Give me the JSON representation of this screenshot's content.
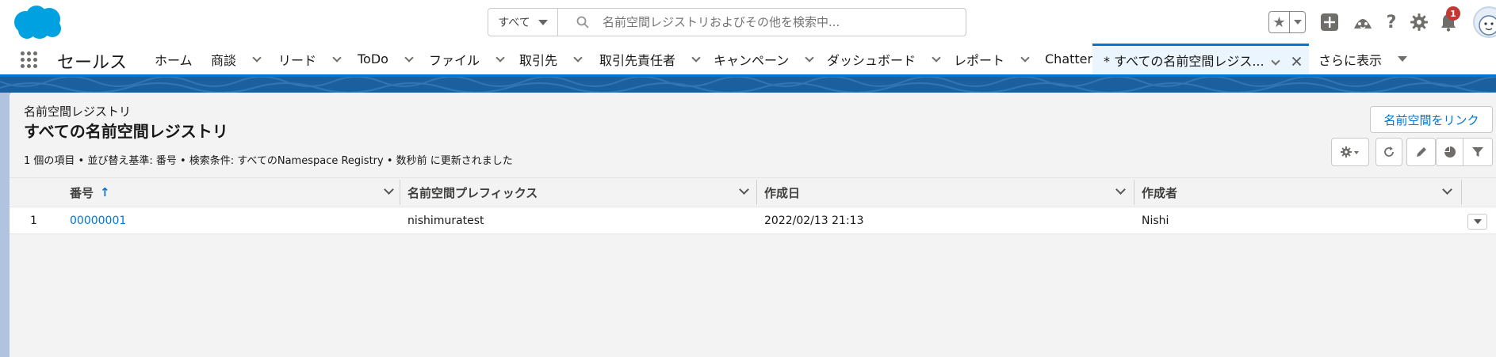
{
  "header": {
    "search_scope": "すべて",
    "search_placeholder": "名前空間レジストリおよびその他を検索中...",
    "notification_count": "1",
    "icons": [
      "salesforce-cloud-icon",
      "search-icon",
      "star-icon",
      "add-icon",
      "trailhead-icon",
      "help-icon",
      "setup-gear-icon",
      "bell-icon",
      "avatar"
    ]
  },
  "nav": {
    "app_name": "セールス",
    "items": [
      {
        "label": "ホーム",
        "has_menu": false
      },
      {
        "label": "商談",
        "has_menu": true
      },
      {
        "label": "リード",
        "has_menu": true
      },
      {
        "label": "ToDo",
        "has_menu": true
      },
      {
        "label": "ファイル",
        "has_menu": true
      },
      {
        "label": "取引先",
        "has_menu": true
      },
      {
        "label": "取引先責任者",
        "has_menu": true
      },
      {
        "label": "キャンペーン",
        "has_menu": true
      },
      {
        "label": "ダッシュボード",
        "has_menu": true
      },
      {
        "label": "レポート",
        "has_menu": true
      },
      {
        "label": "Chatter",
        "has_menu": false
      }
    ],
    "active_tab": "* すべての名前空間レジス...",
    "more_label": "さらに表示"
  },
  "list_view": {
    "object_label": "名前空間レジストリ",
    "title": "すべての名前空間レジストリ",
    "info": "1 個の項目 • 並び替え基準: 番号 • 検索条件: すべてのNamespace Registry • 数秒前 に更新されました",
    "link_button": "名前空間をリンク",
    "columns": [
      "番号",
      "名前空間プレフィックス",
      "作成日",
      "作成者"
    ],
    "sort_indicator": "↑",
    "rows": [
      {
        "index": "1",
        "number": "00000001",
        "prefix": "nishimuratest",
        "created_date": "2022/02/13 21:13",
        "created_by": "Nishi"
      }
    ]
  },
  "colors": {
    "brand_blue": "#0176d3",
    "band_blue": "#1b5f9e",
    "active_tab_bg": "#eaf5fe",
    "badge_red": "#c23934"
  }
}
